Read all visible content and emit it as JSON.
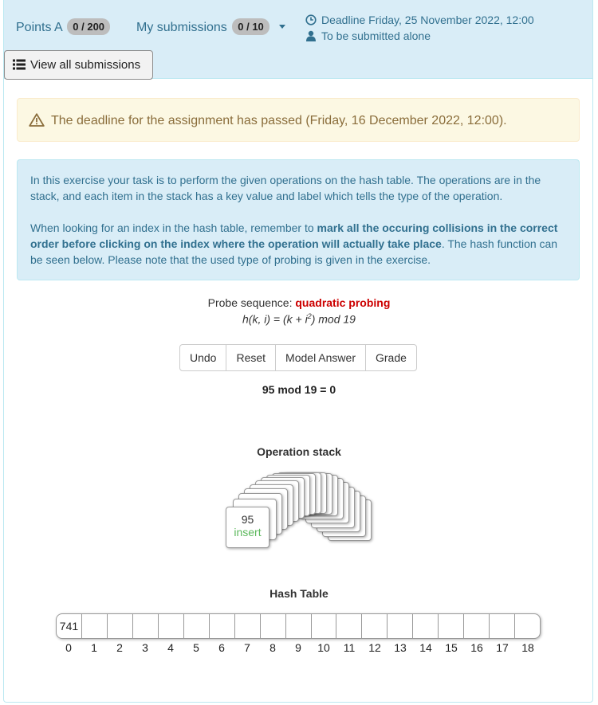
{
  "header": {
    "points_label": "Points A",
    "points_value": "0 / 200",
    "submissions_label": "My submissions",
    "submissions_value": "0 / 10",
    "deadline": "Deadline Friday, 25 November 2022, 12:00",
    "submit_mode": "To be submitted alone",
    "view_all": "View all submissions"
  },
  "warning": {
    "text": "The deadline for the assignment has passed (Friday, 16 December 2022, 12:00)."
  },
  "info": {
    "p1": "In this exercise your task is to perform the given operations on the hash table. The operations are in the stack, and each item in the stack has a key value and label which tells the type of the operation.",
    "p2_before": "When looking for an index in the hash table, remember to ",
    "p2_bold": "mark all the occuring collisions in the correct order before clicking on the index where the operation will actually take place",
    "p2_after": ". The hash function can be seen below. Please note that the used type of probing is given in the exercise."
  },
  "probe": {
    "label": "Probe sequence:",
    "type": "quadratic probing",
    "formula_pre": "h(k, i) = (k + i",
    "formula_sup": "2",
    "formula_post": ") mod 19"
  },
  "buttons": {
    "undo": "Undo",
    "reset": "Reset",
    "model_answer": "Model Answer",
    "grade": "Grade"
  },
  "mod_text": "95 mod 19 = 0",
  "stack": {
    "title": "Operation stack",
    "top_key": "95",
    "top_op": "insert"
  },
  "hash_table": {
    "title": "Hash Table",
    "cells": [
      "741",
      "",
      "",
      "",
      "",
      "",
      "",
      "",
      "",
      "",
      "",
      "",
      "",
      "",
      "",
      "",
      "",
      "",
      ""
    ],
    "indices": [
      "0",
      "1",
      "2",
      "3",
      "4",
      "5",
      "6",
      "7",
      "8",
      "9",
      "10",
      "11",
      "12",
      "13",
      "14",
      "15",
      "16",
      "17",
      "18"
    ]
  },
  "colors": {
    "info_bg": "#d9edf7",
    "info_text": "#31708f",
    "warning_bg": "#fcf8e3",
    "warning_text": "#8a6d3b",
    "probe_type": "#cc0000",
    "op_insert": "#5cb85c"
  },
  "icons": {
    "clock": "clock-icon",
    "user": "user-icon",
    "list": "list-icon",
    "warning": "warning-triangle-icon"
  }
}
